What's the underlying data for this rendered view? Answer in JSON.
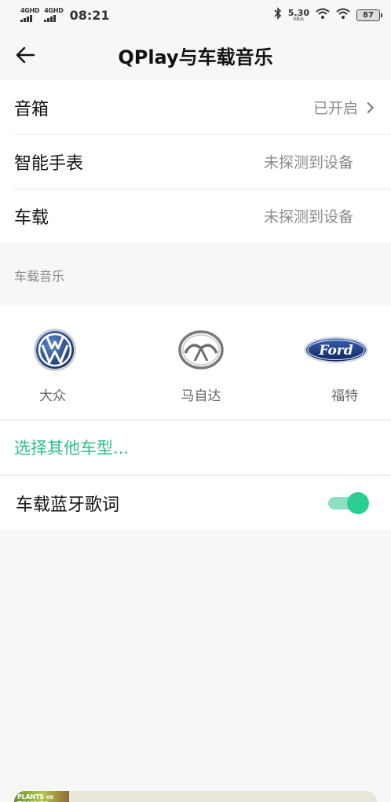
{
  "status_bar": {
    "network_1": "4GHD",
    "network_2": "4GHD",
    "time": "08:21",
    "speed_value": "5.30",
    "speed_unit": "KB/s",
    "battery": "87"
  },
  "header": {
    "title": "QPlay与车载音乐"
  },
  "devices": [
    {
      "name": "音箱",
      "status": "已开启"
    },
    {
      "name": "智能手表",
      "status": "未探测到设备"
    },
    {
      "name": "车载",
      "status": "未探测到设备"
    }
  ],
  "car_section": {
    "label": "车载音乐",
    "brands": [
      {
        "name": "大众",
        "icon": "volkswagen-logo"
      },
      {
        "name": "马自达",
        "icon": "mazda-logo"
      },
      {
        "name": "福特",
        "icon": "ford-logo",
        "logo_text": "Ford"
      }
    ],
    "other_cars": "选择其他车型...",
    "lyrics_label": "车载蓝牙歌词",
    "lyrics_enabled": true
  },
  "mini_player": {
    "cover_text": "PLANTS vs ZOMBIES"
  },
  "colors": {
    "accent": "#2bbf8e",
    "background": "#f7f7f7"
  }
}
